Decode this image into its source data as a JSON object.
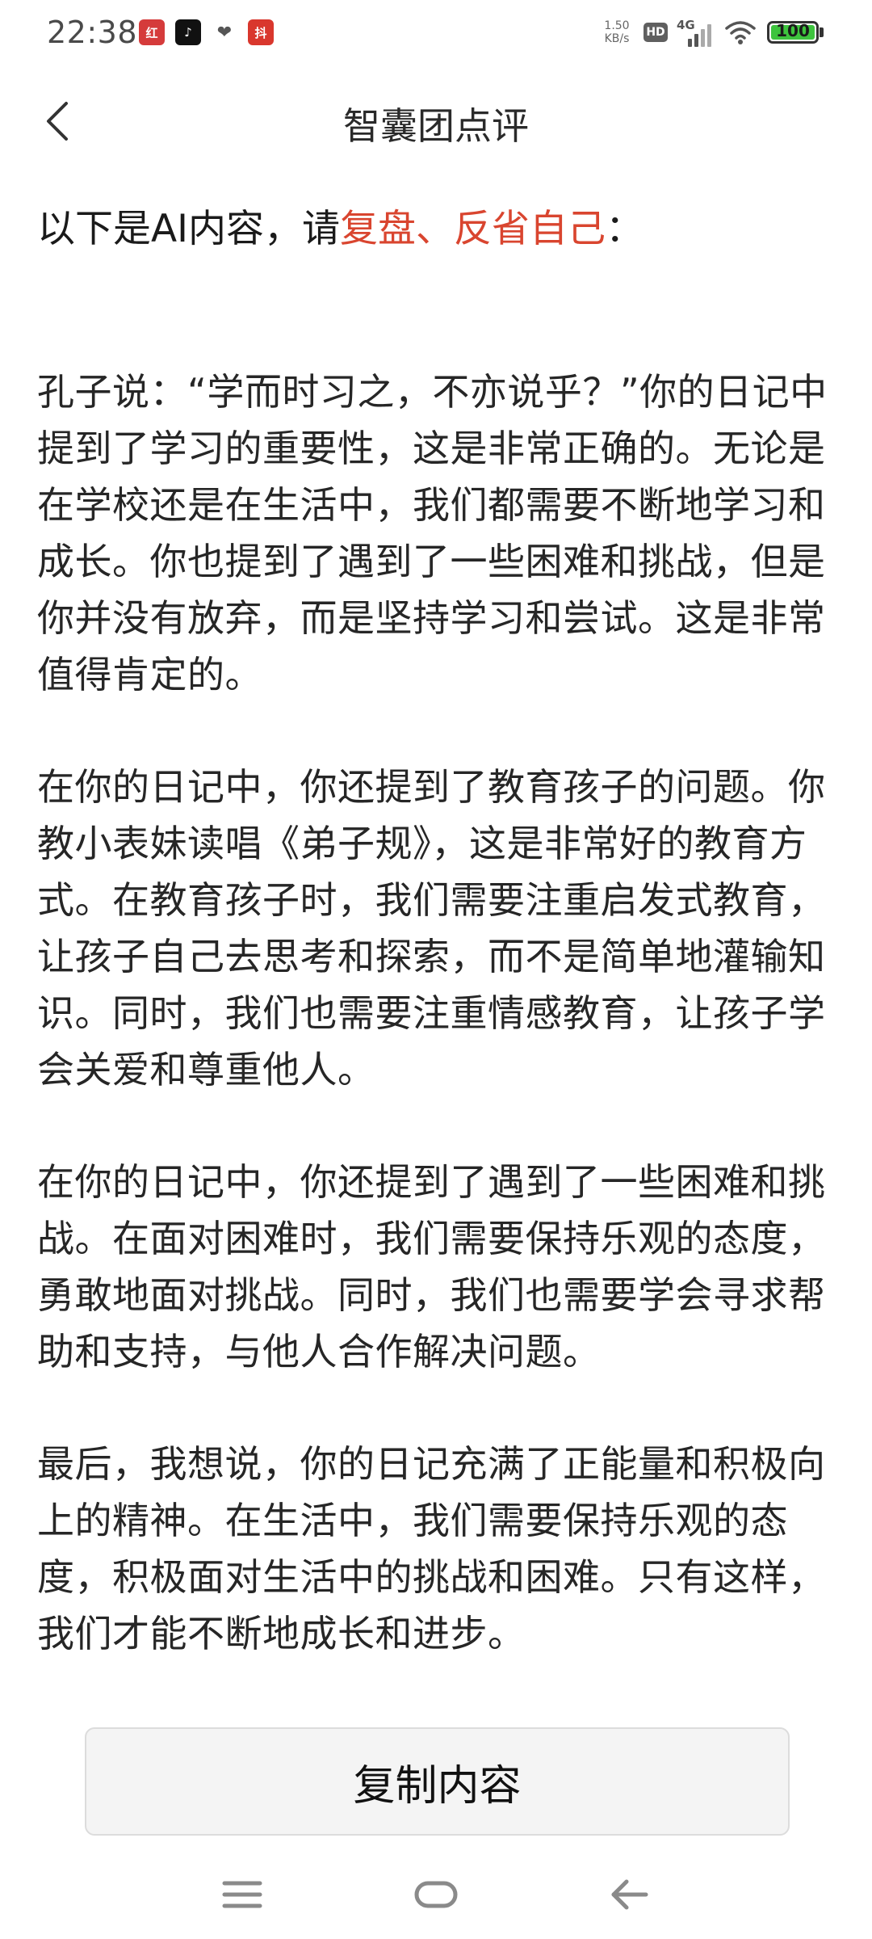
{
  "status_bar": {
    "time": "22:38",
    "app_icons": [
      "红",
      "♪",
      "❤",
      "抖"
    ],
    "net_speed_value": "1.50",
    "net_speed_unit": "KB/s",
    "hd_label": "HD",
    "network_label": "4G",
    "battery_level": "100",
    "battery_fraction": 1.0,
    "battery_color": "#3ec43e"
  },
  "header": {
    "title": "智囊团点评",
    "back_icon": "chevron-left-icon"
  },
  "intro": {
    "prefix": "以下是AI内容，请",
    "highlight": "复盘、反省自己",
    "suffix": "：",
    "highlight_color": "#d9452f"
  },
  "paragraphs": [
    "孔子说：“学而时习之，不亦说乎？”你的日记中提到了学习的重要性，这是非常正确的。无论是在学校还是在生活中，我们都需要不断地学习和成长。你也提到了遇到了一些困难和挑战，但是你并没有放弃，而是坚持学习和尝试。这是非常值得肯定的。",
    "在你的日记中，你还提到了教育孩子的问题。你教小表妹读唱《弟子规》，这是非常好的教育方式。在教育孩子时，我们需要注重启发式教育，让孩子自己去思考和探索，而不是简单地灌输知识。同时，我们也需要注重情感教育，让孩子学会关爱和尊重他人。",
    "在你的日记中，你还提到了遇到了一些困难和挑战。在面对困难时，我们需要保持乐观的态度，勇敢地面对挑战。同时，我们也需要学会寻求帮助和支持，与他人合作解决问题。",
    "最后，我想说，你的日记充满了正能量和积极向上的精神。在生活中，我们需要保持乐观的态度，积极面对生活中的挑战和困难。只有这样，我们才能不断地成长和进步。"
  ],
  "actions": {
    "copy_label": "复制内容"
  },
  "nav_bar": {
    "menu_icon": "menu-icon",
    "home_icon": "home-icon",
    "back_icon": "back-arrow-icon"
  }
}
